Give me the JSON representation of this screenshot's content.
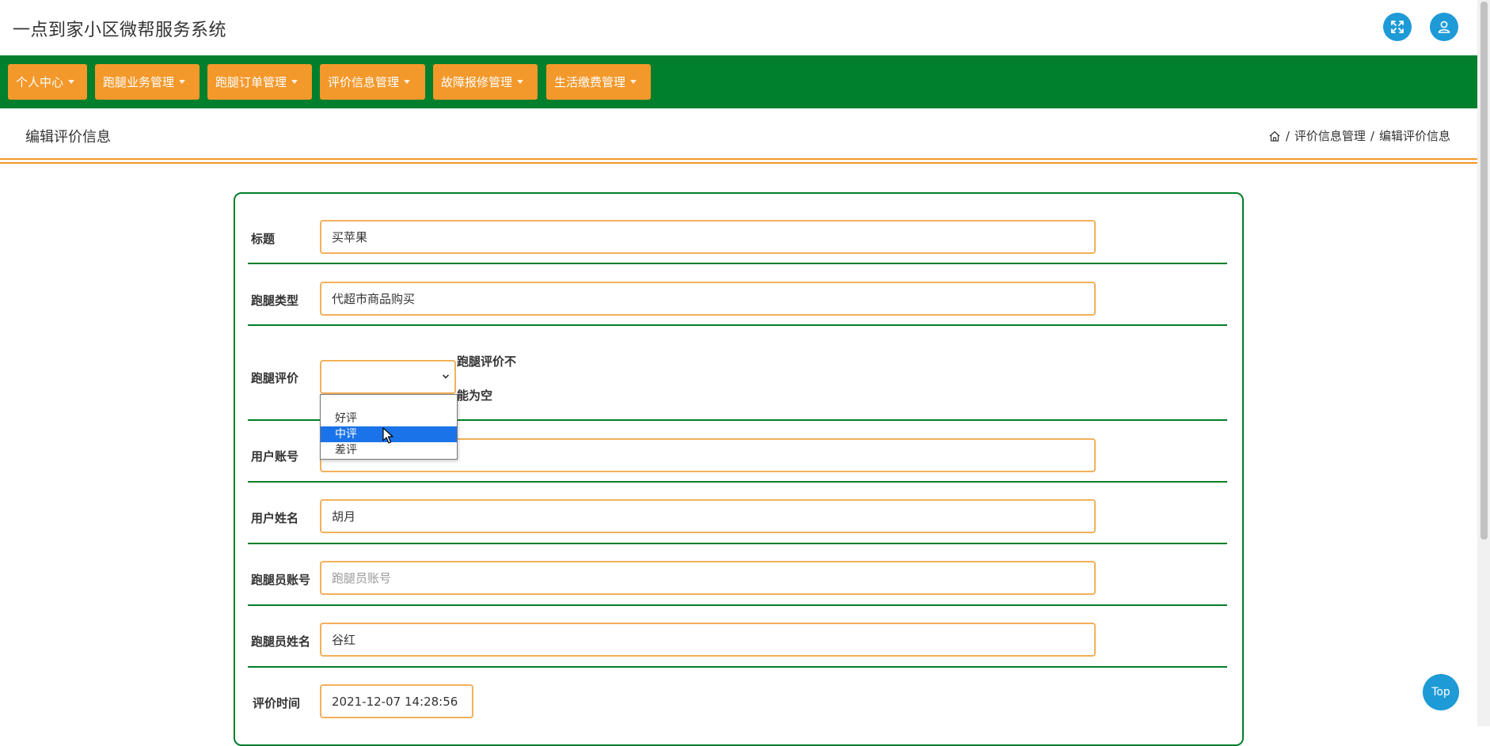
{
  "app": {
    "title": "一点到家小区微帮服务系统",
    "accent_green": "#007f2d",
    "accent_orange": "#f3982a",
    "accent_blue": "#1e9bd7"
  },
  "header": {
    "fullscreen_icon": "expand-icon",
    "user_icon": "user-icon"
  },
  "nav": {
    "items": [
      {
        "label": "个人中心"
      },
      {
        "label": "跑腿业务管理"
      },
      {
        "label": "跑腿订单管理"
      },
      {
        "label": "评价信息管理"
      },
      {
        "label": "故障报修管理"
      },
      {
        "label": "生活缴费管理"
      }
    ]
  },
  "page": {
    "title": "编辑评价信息",
    "breadcrumb": {
      "home_icon": "home-icon",
      "sep": "/",
      "level1": "评价信息管理",
      "level2": "编辑评价信息"
    }
  },
  "form": {
    "title": {
      "label": "标题",
      "value": "买苹果"
    },
    "type": {
      "label": "跑腿类型",
      "value": "代超市商品购买"
    },
    "rating": {
      "label": "跑腿评价",
      "value": "",
      "error_line1": "跑腿评价不",
      "error_line2": "能为空",
      "options": [
        "",
        "好评",
        "中评",
        "差评"
      ],
      "highlighted": "中评"
    },
    "user_account": {
      "label": "用户账号",
      "value": ""
    },
    "user_name": {
      "label": "用户姓名",
      "value": "胡月"
    },
    "runner_account": {
      "label": "跑腿员账号",
      "placeholder": "跑腿员账号",
      "value": ""
    },
    "runner_name": {
      "label": "跑腿员姓名",
      "value": "谷红"
    },
    "rating_time": {
      "label": "评价时间",
      "value": "2021-12-07 14:28:56"
    }
  },
  "top_button": {
    "label": "Top"
  }
}
